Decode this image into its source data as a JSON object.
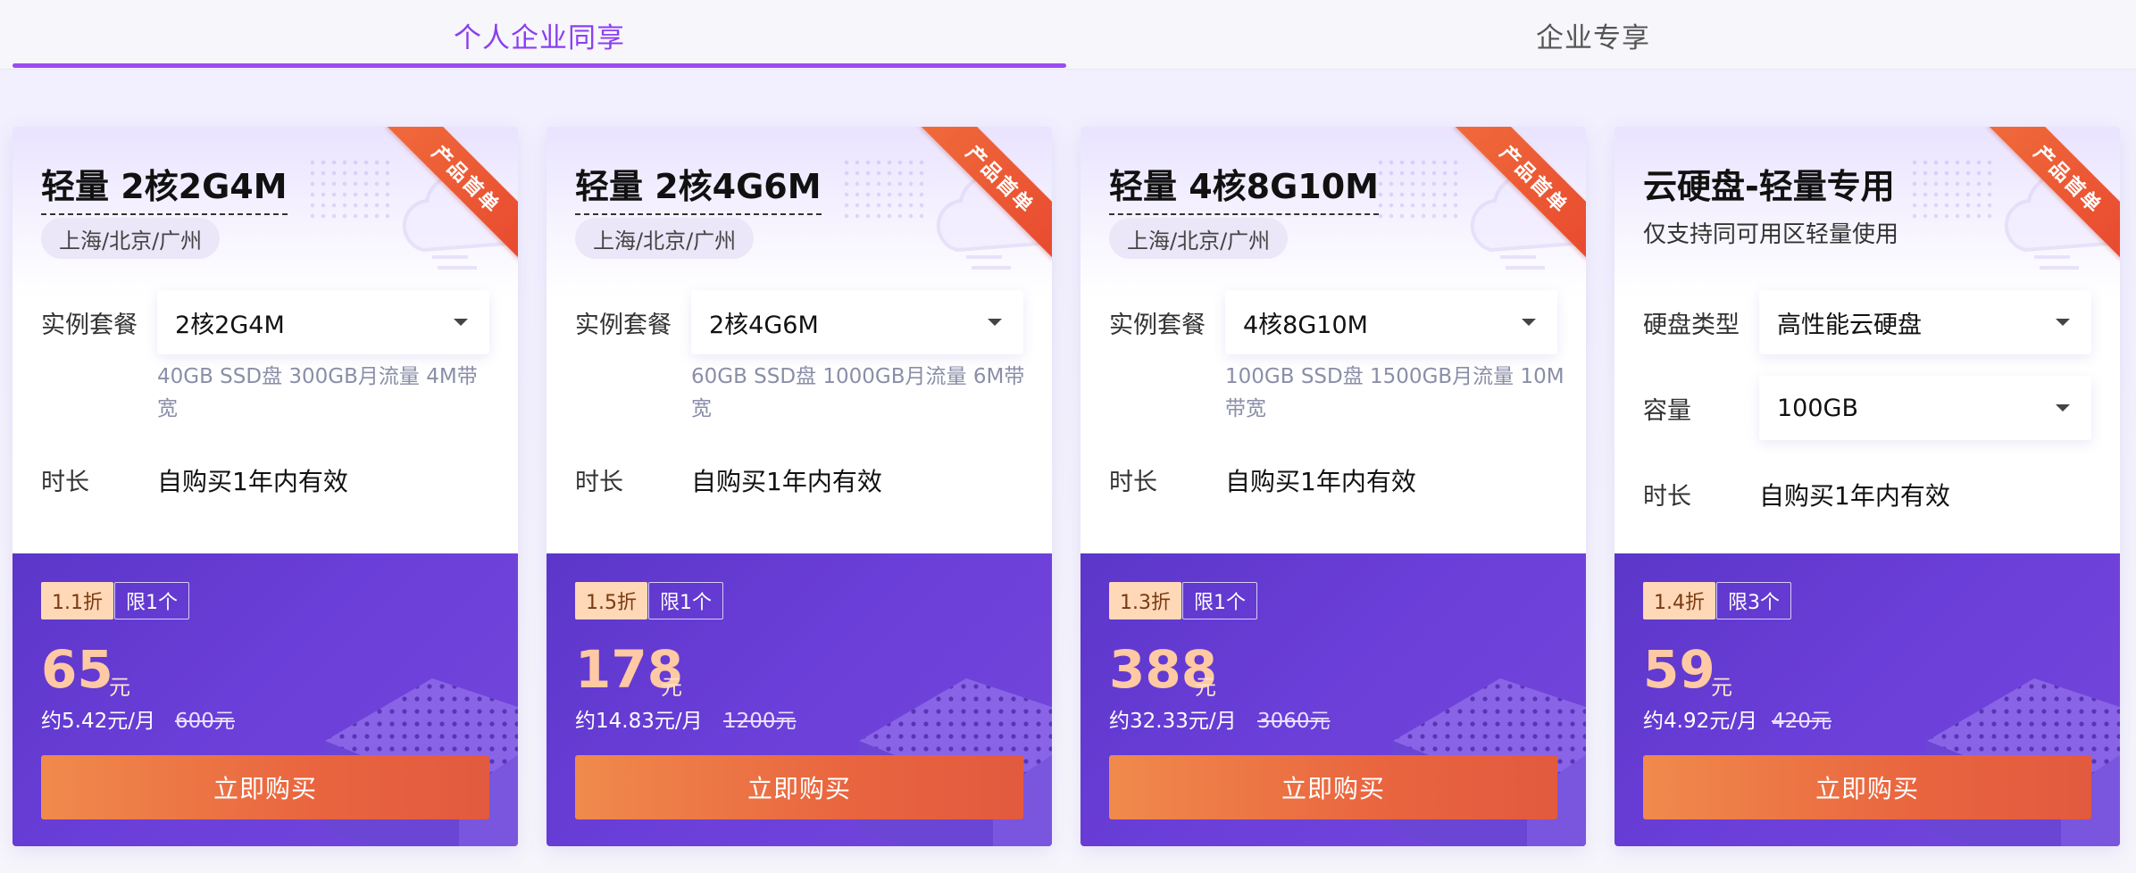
{
  "tabs": [
    {
      "label": "个人企业同享",
      "active": true
    },
    {
      "label": "企业专享",
      "active": false
    }
  ],
  "cards": [
    {
      "ribbon": "产品首单",
      "title": "轻量 2核2G4M",
      "region": "上海/北京/广州",
      "row1_label": "实例套餐",
      "select1": "2核2G4M",
      "spec": "40GB SSD盘 300GB月流量 4M带宽",
      "duration_label": "时长",
      "duration_value": "自购买1年内有效",
      "discount": "1.1折",
      "limit": "限1个",
      "price": "65",
      "price_unit": "元",
      "monthly": "约5.42元/月",
      "original": "600元",
      "buy": "立即购买"
    },
    {
      "ribbon": "产品首单",
      "title": "轻量 2核4G6M",
      "region": "上海/北京/广州",
      "row1_label": "实例套餐",
      "select1": "2核4G6M",
      "spec": "60GB SSD盘 1000GB月流量 6M带宽",
      "duration_label": "时长",
      "duration_value": "自购买1年内有效",
      "discount": "1.5折",
      "limit": "限1个",
      "price": "178",
      "price_unit": "元",
      "monthly": "约14.83元/月",
      "original": "1200元",
      "buy": "立即购买"
    },
    {
      "ribbon": "产品首单",
      "title": "轻量 4核8G10M",
      "region": "上海/北京/广州",
      "row1_label": "实例套餐",
      "select1": "4核8G10M",
      "spec": "100GB SSD盘 1500GB月流量 10M带宽",
      "duration_label": "时长",
      "duration_value": "自购买1年内有效",
      "discount": "1.3折",
      "limit": "限1个",
      "price": "388",
      "price_unit": "元",
      "monthly": "约32.33元/月",
      "original": "3060元",
      "buy": "立即购买"
    },
    {
      "ribbon": "产品首单",
      "title": "云硬盘-轻量专用",
      "subtitle": "仅支持同可用区轻量使用",
      "row1_label": "硬盘类型",
      "select1": "高性能云硬盘",
      "row2_label": "容量",
      "select2": "100GB",
      "duration_label": "时长",
      "duration_value": "自购买1年内有效",
      "discount": "1.4折",
      "limit": "限3个",
      "price": "59",
      "price_unit": "元",
      "monthly": "约4.92元/月",
      "original": "420元",
      "buy": "立即购买"
    }
  ],
  "colors": {
    "tab_active": "#8a3ff0",
    "price_bg": "#6a3ed8",
    "buy_button": "#e9653f",
    "ribbon": "#ee5a33",
    "price_text": "#ffc9a3"
  }
}
